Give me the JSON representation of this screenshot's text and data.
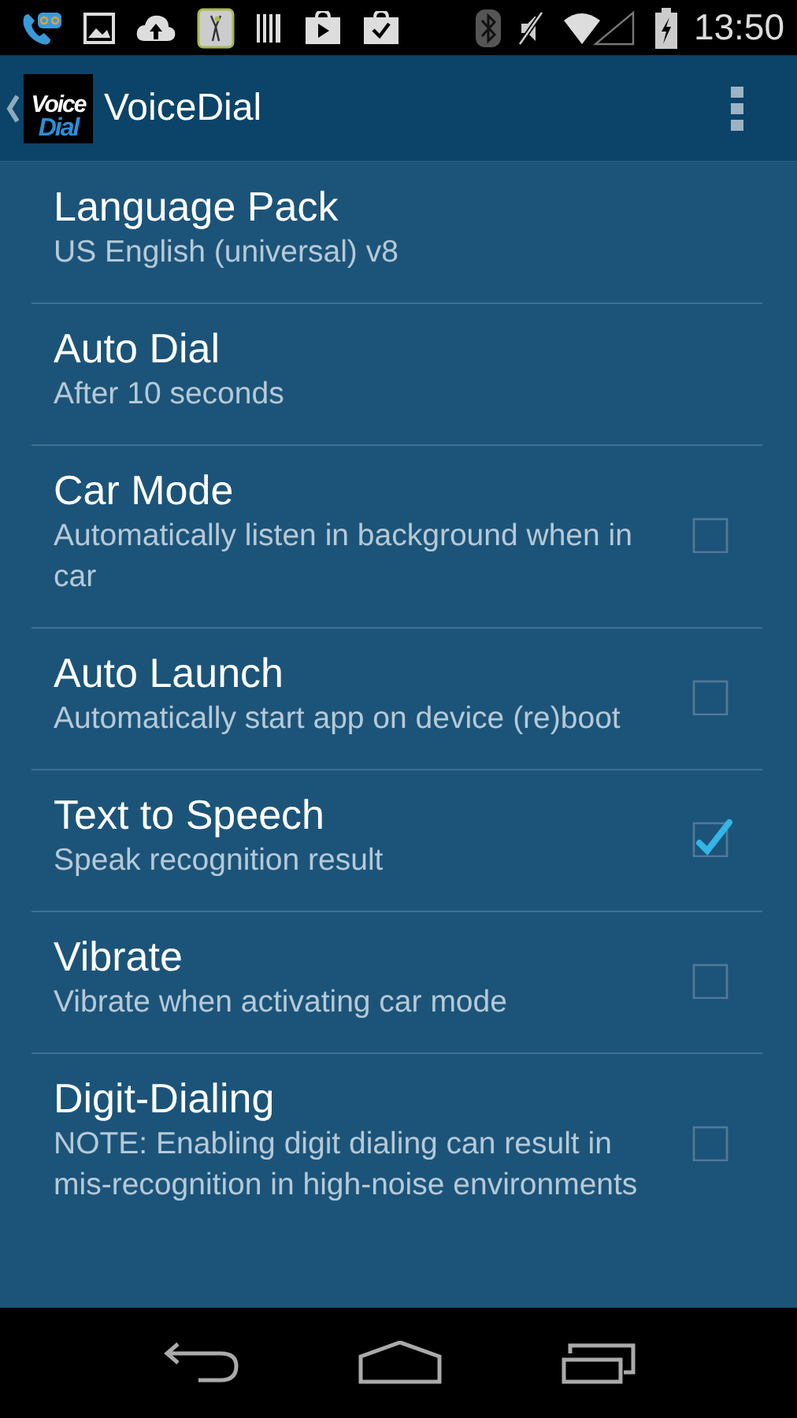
{
  "status_bar": {
    "time": "13:50"
  },
  "app_bar": {
    "logo": {
      "top": "Voice",
      "bottom": "Dial"
    },
    "title": "VoiceDial"
  },
  "settings": [
    {
      "kind": "text",
      "title": "Language Pack",
      "summary": "US English (universal) v8"
    },
    {
      "kind": "text",
      "title": "Auto Dial",
      "summary": "After 10 seconds"
    },
    {
      "kind": "checkbox",
      "title": "Car Mode",
      "summary": "Automatically listen in background when in car",
      "checked": false
    },
    {
      "kind": "checkbox",
      "title": "Auto Launch",
      "summary": "Automatically start app on device (re)boot",
      "checked": false
    },
    {
      "kind": "checkbox",
      "title": "Text to Speech",
      "summary": "Speak recognition result",
      "checked": true
    },
    {
      "kind": "checkbox",
      "title": "Vibrate",
      "summary": "Vibrate when activating car mode",
      "checked": false
    },
    {
      "kind": "checkbox",
      "title": "Digit-Dialing",
      "summary": "NOTE: Enabling digit dialing can result in mis-recognition in high-noise environments",
      "checked": false
    }
  ]
}
